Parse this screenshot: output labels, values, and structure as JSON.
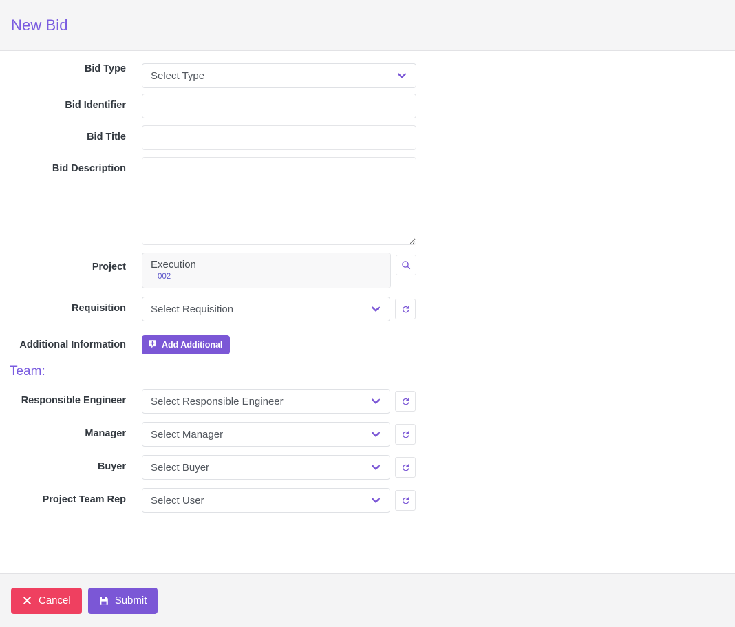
{
  "header": {
    "title": "New Bid",
    "title_color": "#7a5ce0"
  },
  "theme": {
    "accent": "#7b57d6",
    "accent_text": "#7a5ce0",
    "danger": "#ef4060",
    "header_bg": "#f5f5f6",
    "footer_bg": "#f4f4f5",
    "field_border": "#e4e5e8",
    "readonly_bg": "#f8f8f9"
  },
  "form": {
    "bid_type": {
      "label": "Bid Type",
      "value": "Select Type",
      "control": "select",
      "icon": "chevron-down-icon"
    },
    "bid_identifier": {
      "label": "Bid Identifier",
      "value": "",
      "placeholder": "",
      "control": "text"
    },
    "bid_title": {
      "label": "Bid Title",
      "value": "",
      "placeholder": "",
      "control": "text"
    },
    "bid_description": {
      "label": "Bid Description",
      "value": "",
      "placeholder": "",
      "control": "textarea"
    },
    "project": {
      "label": "Project",
      "name": "Execution",
      "code": "002",
      "control": "readonly",
      "action_icon": "search-icon"
    },
    "requisition": {
      "label": "Requisition",
      "value": "Select Requisition",
      "control": "select",
      "icon": "chevron-down-icon",
      "action_icon": "refresh-icon"
    },
    "additional_information": {
      "label": "Additional Information",
      "button_label": "Add Additional",
      "button_icon": "add-note-icon"
    }
  },
  "team": {
    "heading": "Team:",
    "fields": [
      {
        "label": "Responsible Engineer",
        "value": "Select Responsible Engineer",
        "icon": "chevron-down-icon",
        "action_icon": "refresh-icon"
      },
      {
        "label": "Manager",
        "value": "Select Manager",
        "icon": "chevron-down-icon",
        "action_icon": "refresh-icon"
      },
      {
        "label": "Buyer",
        "value": "Select Buyer",
        "icon": "chevron-down-icon",
        "action_icon": "refresh-icon"
      },
      {
        "label": "Project Team Rep",
        "value": "Select User",
        "icon": "chevron-down-icon",
        "action_icon": "refresh-icon"
      }
    ]
  },
  "footer": {
    "cancel_label": "Cancel",
    "cancel_icon": "close-x-icon",
    "submit_label": "Submit",
    "submit_icon": "save-disk-icon"
  }
}
